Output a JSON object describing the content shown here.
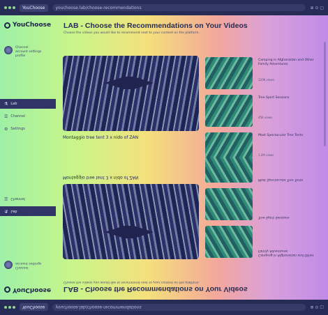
{
  "browser": {
    "tab": "YouChoose",
    "url": "youchoose.lab/choose-recommendations",
    "end": "⊕ ⊙ ▢"
  },
  "app": {
    "logo": "YouChoose"
  },
  "page": {
    "title": "LAB - Choose the Recommendations on Your Videos",
    "description": "Choose the videos you would like to recommend next to your content on the platform."
  },
  "user": {
    "line1": "Channel",
    "line2": "account settings",
    "line3": "profile"
  },
  "nav": [
    {
      "label": "Lab",
      "icon": "⚗"
    },
    {
      "label": "Channel",
      "icon": "☰"
    },
    {
      "label": "Settings",
      "icon": "⚙"
    }
  ],
  "video": {
    "title": "Montaggio tree tent 3 x nido of ZAN"
  },
  "recommendations": [
    {
      "title": "Camping in Afghanistan and Other Family Adventures",
      "meta": "120K views"
    },
    {
      "title": "Tree Spirit Sessions",
      "meta": "45K views"
    },
    {
      "title": "Most Spectacular Tree Tents",
      "meta": "1.2M views"
    },
    {
      "title": "",
      "meta": ""
    }
  ],
  "colors": {
    "bar": "#262c56",
    "accent": "#2f3566"
  }
}
